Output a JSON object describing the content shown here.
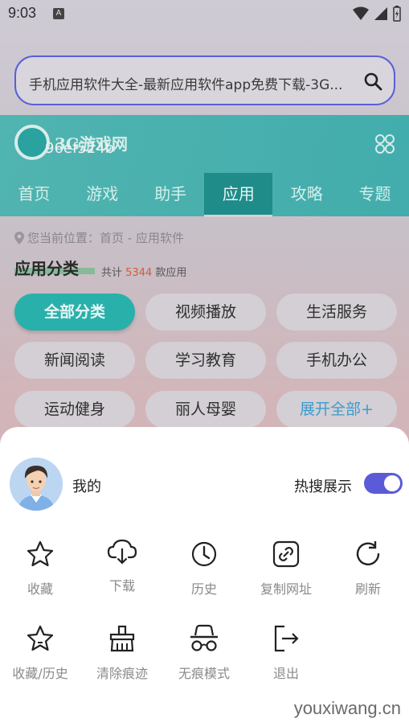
{
  "status": {
    "time": "9:03",
    "a_badge": "A"
  },
  "browser": {
    "url_text": "手机应用软件大全-最新应用软件app免费下载-3G..."
  },
  "site": {
    "logo_text": "3G游戏网",
    "overlay_id": "96ef524b",
    "nav": [
      "首页",
      "游戏",
      "助手",
      "应用",
      "攻略",
      "专题"
    ],
    "breadcrumb": "您当前位置：首页 - 应用软件",
    "category_title": "应用分类",
    "count_prefix": "共计",
    "count_num": "5344",
    "count_suffix": "款应用",
    "chips": [
      "全部分类",
      "视频播放",
      "生活服务",
      "新闻阅读",
      "学习教育",
      "手机办公",
      "运动健身",
      "丽人母婴",
      "展开全部+"
    ]
  },
  "sheet": {
    "my_label": "我的",
    "hot_search_label": "热搜展示",
    "hot_search_on": true,
    "menu": [
      {
        "label": "收藏",
        "icon": "star-icon"
      },
      {
        "label": "下载",
        "icon": "cloud-download-icon"
      },
      {
        "label": "历史",
        "icon": "clock-icon"
      },
      {
        "label": "复制网址",
        "icon": "link-icon"
      },
      {
        "label": "刷新",
        "icon": "refresh-icon"
      },
      {
        "label": "收藏/历史",
        "icon": "star-box-icon"
      },
      {
        "label": "清除痕迹",
        "icon": "broom-icon"
      },
      {
        "label": "无痕模式",
        "icon": "incognito-icon"
      },
      {
        "label": "退出",
        "icon": "exit-icon"
      }
    ]
  },
  "watermark": "youxiwang.cn",
  "colors": {
    "accent": "#5b5bd8",
    "teal": "#2ab0aa"
  }
}
